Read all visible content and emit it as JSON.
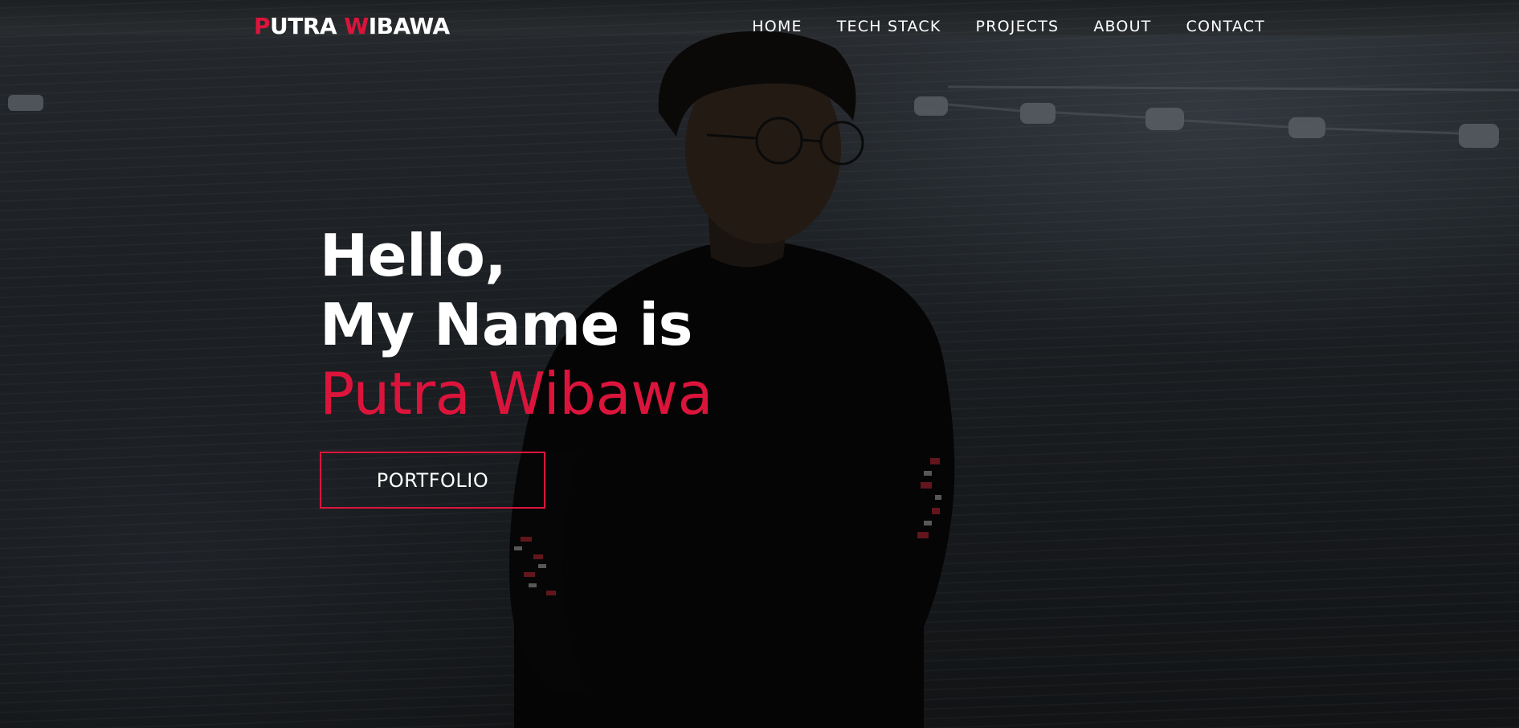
{
  "nav": {
    "logo": {
      "first_initial": "P",
      "first_rest": "UTRA",
      "second_initial": "W",
      "second_rest": "IBAWA"
    },
    "items": [
      {
        "label": "HOME"
      },
      {
        "label": "TECH STACK"
      },
      {
        "label": "PROJECTS"
      },
      {
        "label": "ABOUT"
      },
      {
        "label": "CONTACT"
      }
    ]
  },
  "hero": {
    "line1": "Hello,",
    "line2": "My Name is",
    "name": "Putra Wibawa",
    "button_label": "PORTFOLIO",
    "background_image": "photo of a young man with glasses in a black long-sleeve shirt standing in front of a lake with floating barrels"
  },
  "colors": {
    "accent": "#dc143c",
    "text": "#ffffff",
    "overlay": "#000000"
  }
}
